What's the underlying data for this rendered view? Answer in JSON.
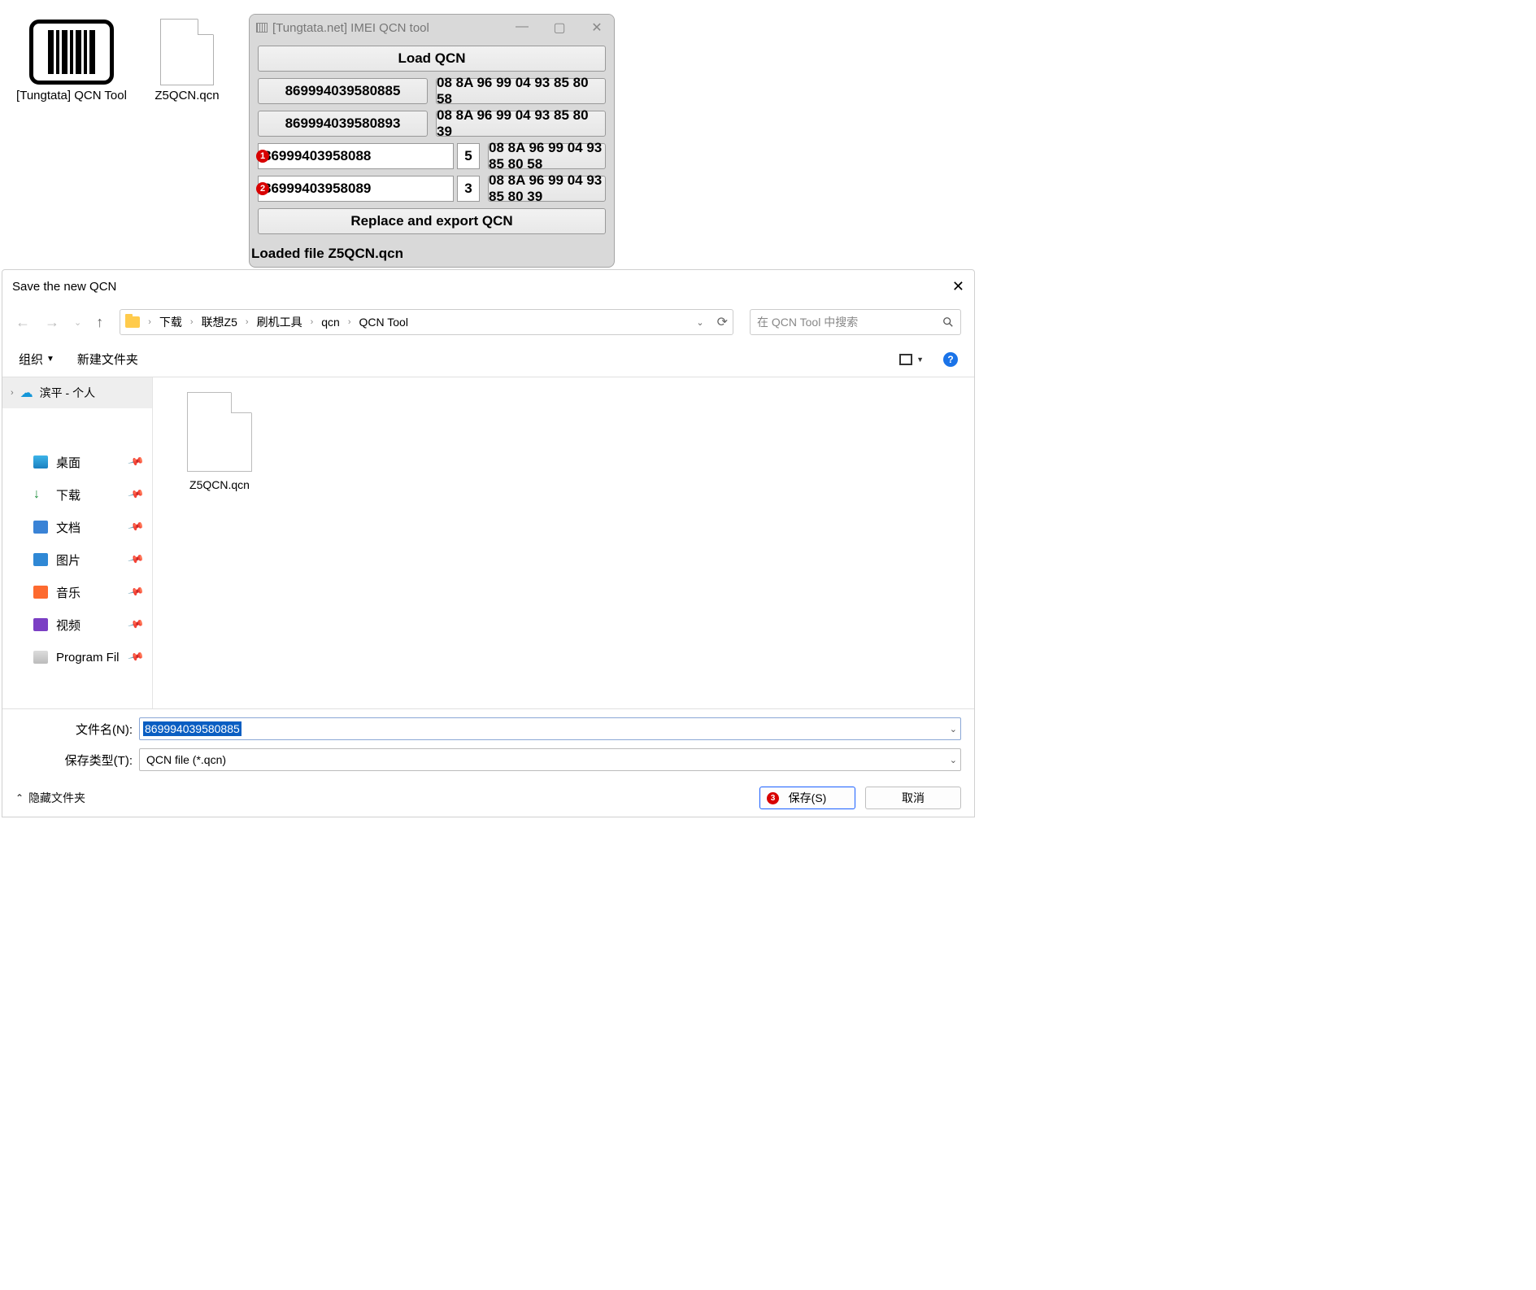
{
  "desktop": {
    "icon1_label": "[Tungtata] QCN Tool",
    "icon2_label": "Z5QCN.qcn"
  },
  "imei_tool": {
    "window_title": "[Tungtata.net] IMEI QCN tool",
    "load_btn": "Load QCN",
    "row1_imei": "869994039580885",
    "row1_hex": "08 8A 96 99 04 93 85 80 58",
    "row2_imei": "869994039580893",
    "row2_hex": "08 8A 96 99 04 93 85 80 39",
    "badge1": "1",
    "input1_main": "86999403958088",
    "input1_cd": "5",
    "input1_hex": "08 8A 96 99 04 93 85 80 58",
    "badge2": "2",
    "input2_main": "86999403958089",
    "input2_cd": "3",
    "input2_hex": "08 8A 96 99 04 93 85 80 39",
    "export_btn": "Replace and export QCN",
    "status": "Loaded file Z5QCN.qcn"
  },
  "save_dialog": {
    "title": "Save the new QCN",
    "breadcrumb": [
      "下载",
      "联想Z5",
      "刷机工具",
      "qcn",
      "QCN Tool"
    ],
    "search_placeholder": "在 QCN Tool 中搜索",
    "organize": "组织",
    "new_folder": "新建文件夹",
    "onedrive": "滨平 - 个人",
    "sidebar": [
      {
        "label": "桌面"
      },
      {
        "label": "下载"
      },
      {
        "label": "文档"
      },
      {
        "label": "图片"
      },
      {
        "label": "音乐"
      },
      {
        "label": "视频"
      },
      {
        "label": "Program Fil"
      }
    ],
    "file_item": "Z5QCN.qcn",
    "filename_label": "文件名(N):",
    "filename_value": "869994039580885",
    "filetype_label": "保存类型(T):",
    "filetype_value": "QCN file (*.qcn)",
    "hide_folders": "隐藏文件夹",
    "badge3": "3",
    "save_btn": "保存(S)",
    "cancel_btn": "取消"
  }
}
